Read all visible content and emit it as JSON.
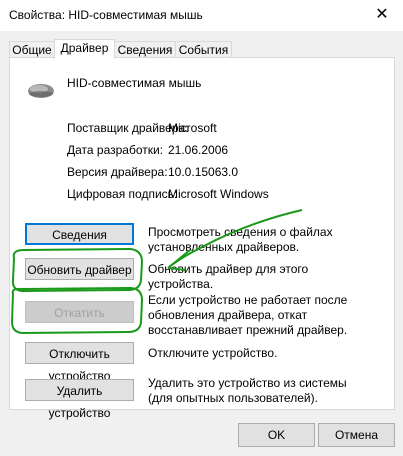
{
  "window": {
    "title": "Свойства: HID-совместимая мышь",
    "close_glyph": "✕"
  },
  "tabs": [
    {
      "label": "Общие"
    },
    {
      "label": "Драйвер"
    },
    {
      "label": "Сведения"
    },
    {
      "label": "События"
    }
  ],
  "device": {
    "name": "HID-совместимая мышь",
    "icon": "mouse-icon"
  },
  "properties": [
    {
      "label": "Поставщик драйвера:",
      "value": "Microsoft"
    },
    {
      "label": "Дата разработки:",
      "value": "21.06.2006"
    },
    {
      "label": "Версия драйвера:",
      "value": "10.0.15063.0"
    },
    {
      "label": "Цифровая подпись:",
      "value": "Microsoft Windows"
    }
  ],
  "actions": [
    {
      "button": "Сведения",
      "description": "Просмотреть сведения о файлах установленных драйверов."
    },
    {
      "button": "Обновить драйвер",
      "description": "Обновить драйвер для этого устройства."
    },
    {
      "button": "Откатить",
      "description": "Если устройство не работает после обновления драйвера, откат восстанавливает прежний драйвер."
    },
    {
      "button": "Отключить устройство",
      "description": "Отключите устройство."
    },
    {
      "button": "Удалить устройство",
      "description": "Удалить это устройство из системы (для опытных пользователей)."
    }
  ],
  "footer": {
    "ok": "OK",
    "cancel": "Отмена"
  },
  "colors": {
    "annotation_green": "#1a9a1a",
    "accent": "#0078d7"
  }
}
